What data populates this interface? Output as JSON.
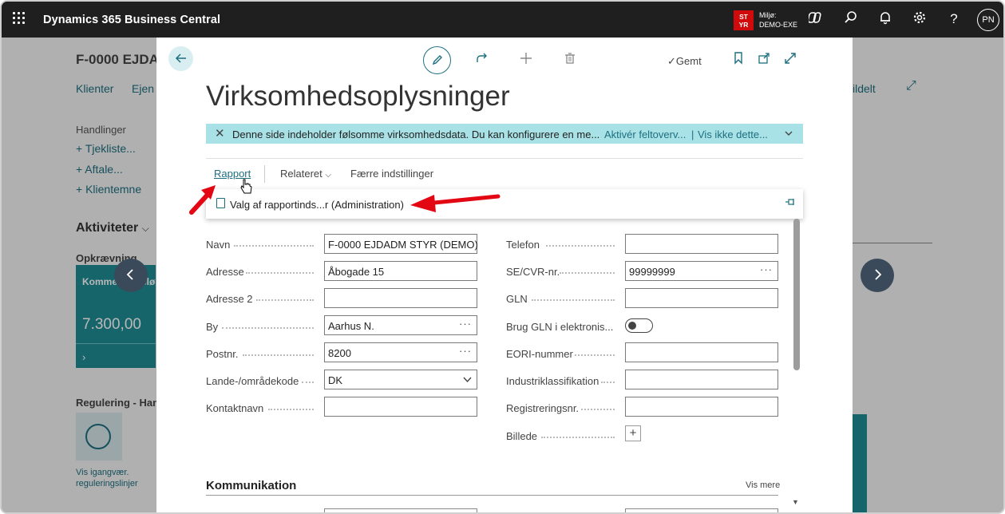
{
  "topbar": {
    "app_title": "Dynamics 365 Business Central",
    "env_badge_line1": "ST",
    "env_badge_line2": "YR",
    "env_label": "Miljø:",
    "env_name": "DEMO-EXE",
    "avatar_initials": "PN",
    "icons": [
      "app-launcher-icon",
      "copilot-icon",
      "search-icon",
      "bell-icon",
      "gear-icon",
      "help-icon"
    ]
  },
  "background": {
    "page_title": "F-0000 EJDA",
    "nav_links": [
      "Klienter",
      "Ejen",
      "ildelt"
    ],
    "actions_header": "Handlinger",
    "actions": [
      "+ Tjekliste...",
      "+ Aftale...",
      "+ Klientemne"
    ],
    "activities_header": "Aktiviteter",
    "billing_header": "Opkrævning",
    "tile_label": "Komme",
    "tile_label_suffix": "elø",
    "tile_value": "7.300,00",
    "tile_arrow": "›",
    "regulation_header": "Regulering - Hand",
    "regulation_link_line1": "Vis igangvær.",
    "regulation_link_line2": "reguleringslinjer"
  },
  "dialog": {
    "saved_label": "Gemt",
    "title": "Virksomhedsoplysninger",
    "banner": {
      "text": "Denne side indeholder følsomme virksomhedsdata. Du kan konfigurere en me...",
      "link1": "Aktivér feltoverv...",
      "separator": "|",
      "link2": "Vis ikke dette..."
    },
    "tabs": {
      "rapport": "Rapport",
      "relateret": "Relateret",
      "faerre": "Færre indstillinger"
    },
    "dropdown_item": "Valg af rapportinds...r (Administration)",
    "left_fields": [
      {
        "label": "Navn",
        "value": "F-0000 EJDADM STYR (DEMO)"
      },
      {
        "label": "Adresse",
        "value": "Åbogade 15"
      },
      {
        "label": "Adresse 2",
        "value": ""
      },
      {
        "label": "By",
        "value": "Aarhus N."
      },
      {
        "label": "Postnr.",
        "value": "8200"
      },
      {
        "label": "Lande-/områdekode",
        "value": "DK"
      },
      {
        "label": "Kontaktnavn",
        "value": ""
      }
    ],
    "right_fields": [
      {
        "label": "Telefon",
        "value": ""
      },
      {
        "label": "SE/CVR-nr.",
        "value": "99999999"
      },
      {
        "label": "GLN",
        "value": ""
      },
      {
        "label": "Brug GLN i elektronis...",
        "value": ""
      },
      {
        "label": "EORI-nummer",
        "value": ""
      },
      {
        "label": "Industriklassifikation",
        "value": ""
      },
      {
        "label": "Registreringsnr.",
        "value": ""
      },
      {
        "label": "Billede",
        "value": ""
      }
    ],
    "more_glyph": "···",
    "section_title": "Kommunikation",
    "section_more": "Vis mere"
  },
  "colors": {
    "accent": "#1d6f80",
    "banner_bg": "#a9e2e6",
    "topbar_bg": "#1f1f1f",
    "annotation_red": "#e30613"
  }
}
